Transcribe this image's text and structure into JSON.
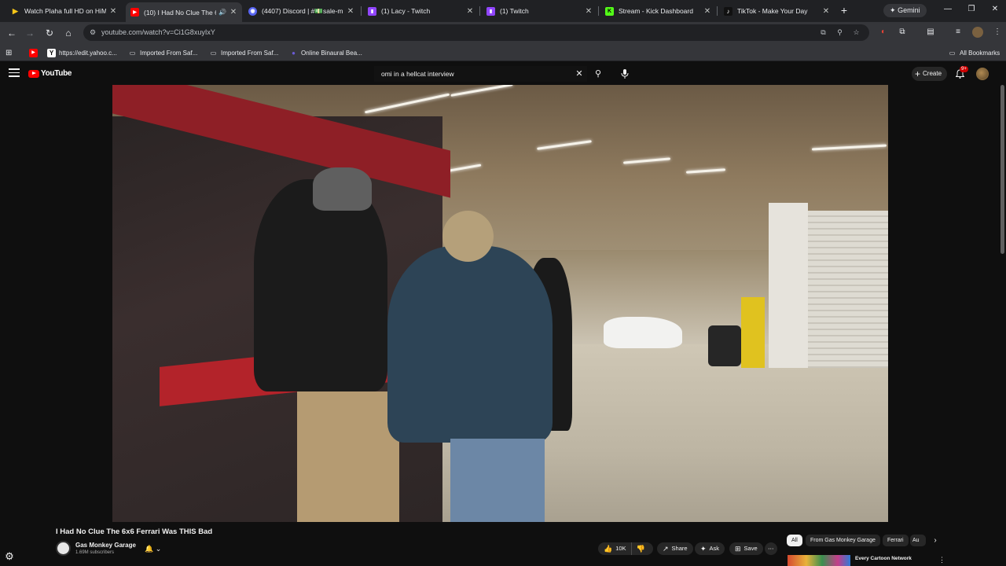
{
  "browser": {
    "tabs": [
      {
        "title": "Watch Plaha full HD on HiMo",
        "favicon_color": "#f5c518",
        "favicon_text": "▶",
        "active": false
      },
      {
        "title": "(10) I Had No Clue The 6x6",
        "favicon_color": "#ff0000",
        "favicon_text": "▶",
        "active": true
      },
      {
        "title": "(4407) Discord | #💵sale-m",
        "favicon_color": "#5865f2",
        "favicon_text": "◉",
        "active": false
      },
      {
        "title": "(1) Lacy - Twitch",
        "favicon_color": "#9146ff",
        "favicon_text": "▮",
        "active": false
      },
      {
        "title": "(1) Twitch",
        "favicon_color": "#9146ff",
        "favicon_text": "▮",
        "active": false
      },
      {
        "title": "Stream - Kick Dashboard",
        "favicon_color": "#53fc18",
        "favicon_text": "K",
        "active": false
      },
      {
        "title": "TikTok - Make Your Day",
        "favicon_color": "#111111",
        "favicon_text": "♪",
        "active": false
      }
    ],
    "new_tab": "+",
    "gemini_label": "Gemini",
    "gemini_icon": "✦",
    "window_controls": {
      "minimize": "—",
      "restore": "❐",
      "close": "✕"
    },
    "nav": {
      "back": "←",
      "forward": "→",
      "reload": "↻",
      "home": "⌂"
    },
    "url": "youtube.com/watch?v=Ci1G8xuyIxY",
    "bookmarks": [
      {
        "label": "",
        "icon": "▶",
        "icon_color": "#ff0000"
      },
      {
        "label": "https://edit.yahoo.c...",
        "icon": "Y",
        "icon_color": "#ffffff"
      },
      {
        "label": "Imported From Saf...",
        "icon": "▭",
        "icon_color": "#e8eaed"
      },
      {
        "label": "Imported From Saf...",
        "icon": "▭",
        "icon_color": "#e8eaed"
      },
      {
        "label": "Online Binaural Bea...",
        "icon": "●",
        "icon_color": "#6b5bd6"
      }
    ],
    "all_bookmarks": "All Bookmarks"
  },
  "youtube": {
    "logo_text": "YouTube",
    "search": {
      "value": "omi in a hellcat interview",
      "clear_icon": "✕",
      "search_icon": "⚲",
      "mic_icon": "🎤"
    },
    "create_label": "Create",
    "create_icon": "+",
    "notification_icon": "🔔",
    "notification_count": "9+",
    "video": {
      "title": "I Had No Clue The 6x6 Ferrari Was THIS Bad",
      "channel": "Gas Monkey Garage",
      "subscribers": "1.69M subscribers",
      "bell": "🔔",
      "bell_caret": "⌄",
      "likes": "10K",
      "like_icon": "👍",
      "dislike_icon": "👎",
      "share_label": "Share",
      "share_icon": "↗",
      "ask_label": "Ask",
      "ask_icon": "✦",
      "save_label": "Save",
      "save_icon": "⊞",
      "more_icon": "⋯"
    },
    "chips": [
      "All",
      "From Gas Monkey Garage",
      "Ferrari",
      "Au"
    ],
    "chip_next": "›",
    "recommendation": {
      "title": "Every Cartoon Network",
      "menu": "⋮"
    },
    "settings_icon": "⚙"
  }
}
